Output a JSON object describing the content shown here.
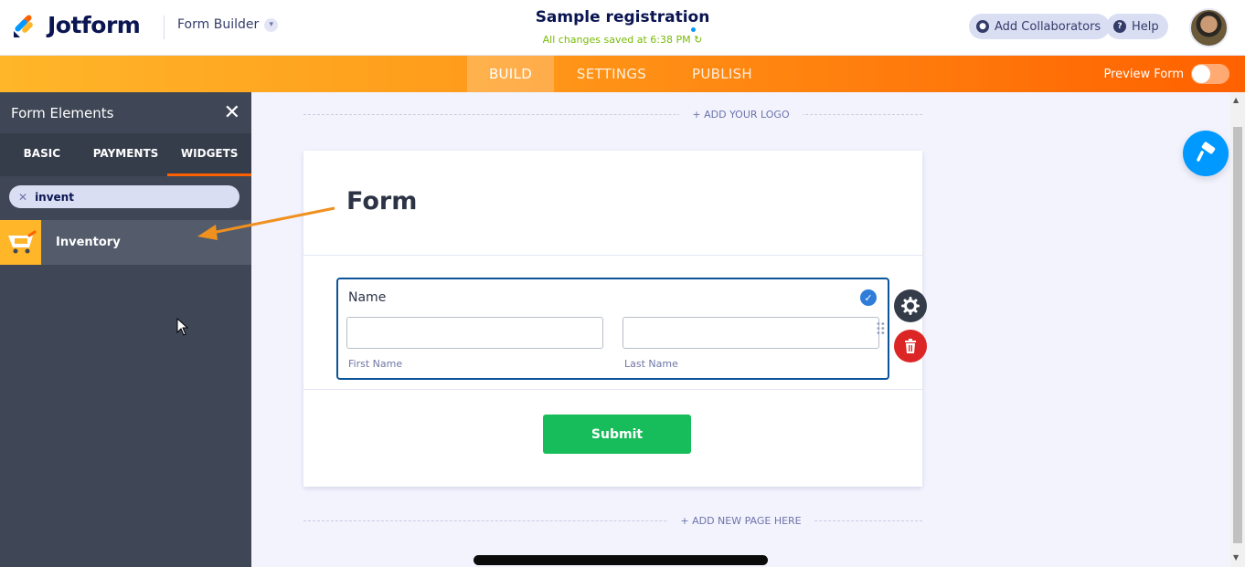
{
  "header": {
    "logo_text": "Jotform",
    "builder_menu": "Form Builder",
    "form_title": "Sample registration",
    "saved_status": "All changes saved at 6:38 PM",
    "add_collaborators": "Add Collaborators",
    "help": "Help"
  },
  "nav": {
    "tabs": [
      "BUILD",
      "SETTINGS",
      "PUBLISH"
    ],
    "active_tab": "BUILD",
    "preview_label": "Preview Form",
    "preview_on": false
  },
  "sidebar": {
    "title": "Form Elements",
    "tabs": [
      "BASIC",
      "PAYMENTS",
      "WIDGETS"
    ],
    "active_tab": "WIDGETS",
    "search_value": "invent",
    "results": [
      {
        "label": "Inventory",
        "icon": "shopping-cart-icon"
      }
    ]
  },
  "canvas": {
    "add_logo": "+ ADD YOUR LOGO",
    "form_heading": "Form",
    "field": {
      "label": "Name",
      "sublabels": [
        "First Name",
        "Last Name"
      ]
    },
    "submit_label": "Submit",
    "add_page": "+ ADD NEW PAGE HERE"
  },
  "colors": {
    "brand_orange": "#ff6100",
    "accent_blue": "#0099ff",
    "submit_green": "#18bd5b",
    "sidebar_bg": "#3f4756",
    "delete_red": "#dc2626"
  }
}
